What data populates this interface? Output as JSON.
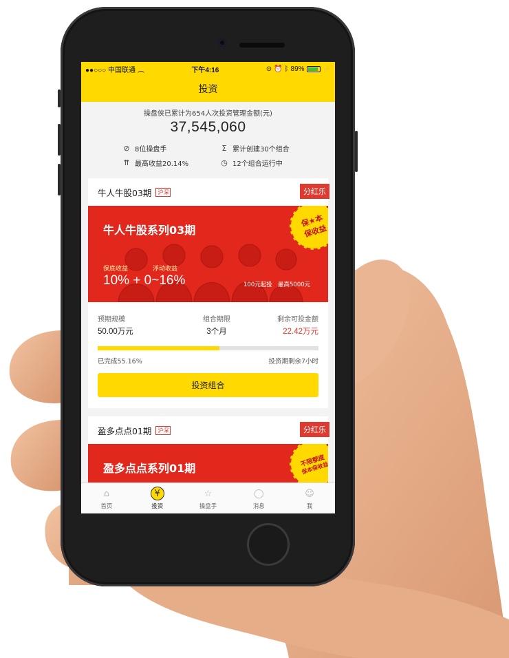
{
  "status_bar": {
    "carrier": "●●○○○ 中国联通",
    "time": "下午4:16",
    "battery": "89%"
  },
  "nav": {
    "title": "投资"
  },
  "summary": {
    "caption": "操盘侠已累计为654人次投资管理金额(元)",
    "amount": "37,545,060",
    "stats": [
      {
        "icon": "check-circle-icon",
        "text": "8位操盘手"
      },
      {
        "icon": "sigma-icon",
        "text": "累计创建30个组合"
      },
      {
        "icon": "trend-up-icon",
        "text": "最高收益20.14%"
      },
      {
        "icon": "clock-icon",
        "text": "12个组合运行中"
      }
    ]
  },
  "cards": [
    {
      "name": "牛人牛股03期",
      "tag": "沪深",
      "ribbon": "分红乐",
      "banner_title": "牛人牛股系列03期",
      "stamp_line1": "保★本",
      "stamp_line2": "保收益",
      "guaranteed_label": "保底收益",
      "floating_label": "浮动收益",
      "returns": "10%  +  0~16%",
      "min_invest": "100元起投",
      "max_invest": "最高5000元",
      "metrics": [
        {
          "label": "预期规模",
          "value": "50.00万元"
        },
        {
          "label": "组合期限",
          "value": "3个月"
        },
        {
          "label": "剩余可投金额",
          "value": "22.42万元"
        }
      ],
      "progress": 55.16,
      "progress_text": "已完成55.16%",
      "remaining_text": "投资期剩余7小时",
      "button": "投资组合"
    },
    {
      "name": "盈多点点01期",
      "tag": "沪深",
      "ribbon": "分红乐",
      "banner_title": "盈多点点系列01期",
      "stamp_line1": "不限额度",
      "stamp_line2": "保本保收益"
    }
  ],
  "tabs": [
    {
      "label": "首页",
      "icon": "home-icon"
    },
    {
      "label": "投资",
      "icon": "yen-icon",
      "active": true
    },
    {
      "label": "操盘手",
      "icon": "star-icon"
    },
    {
      "label": "消息",
      "icon": "chat-icon"
    },
    {
      "label": "我",
      "icon": "user-icon"
    }
  ],
  "colors": {
    "brand_yellow": "#ffd900",
    "banner_red": "#e2271c",
    "accent_red": "#e8362d"
  }
}
